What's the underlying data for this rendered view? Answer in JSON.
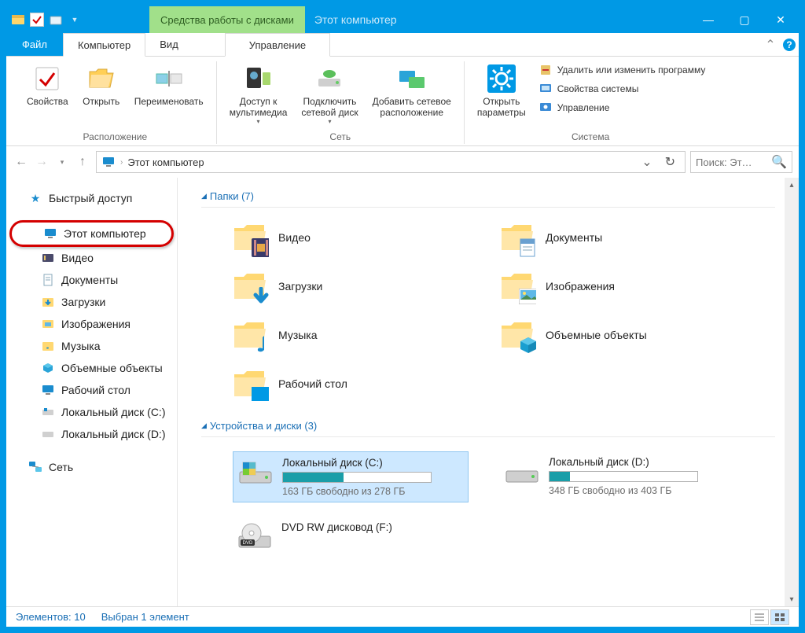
{
  "titlebar": {
    "context_tool": "Средства работы с дисками",
    "title": "Этот компьютер"
  },
  "tabs": {
    "file": "Файл",
    "computer": "Компьютер",
    "view": "Вид",
    "manage": "Управление"
  },
  "ribbon": {
    "properties": "Свойства",
    "open": "Открыть",
    "rename": "Переименовать",
    "group_location": "Расположение",
    "media_access": "Доступ к\nмультимедиа",
    "map_network": "Подключить\nсетевой диск",
    "add_network_location": "Добавить сетевое\nрасположение",
    "group_network": "Сеть",
    "open_settings": "Открыть\nпараметры",
    "uninstall_program": "Удалить или изменить программу",
    "system_properties": "Свойства системы",
    "manage": "Управление",
    "group_system": "Система"
  },
  "address": {
    "path": "Этот компьютер"
  },
  "search": {
    "placeholder": "Поиск: Эт…"
  },
  "sidebar": {
    "quick_access": "Быстрый доступ",
    "this_pc": "Этот компьютер",
    "videos": "Видео",
    "documents": "Документы",
    "downloads": "Загрузки",
    "pictures": "Изображения",
    "music": "Музыка",
    "objects3d": "Объемные объекты",
    "desktop": "Рабочий стол",
    "drive_c": "Локальный диск (C:)",
    "drive_d": "Локальный диск (D:)",
    "network": "Сеть"
  },
  "sections": {
    "folders": "Папки (7)",
    "drives": "Устройства и диски (3)"
  },
  "folders": {
    "videos": "Видео",
    "documents": "Документы",
    "downloads": "Загрузки",
    "pictures": "Изображения",
    "music": "Музыка",
    "objects3d": "Объемные объекты",
    "desktop": "Рабочий стол"
  },
  "drives": {
    "c": {
      "name": "Локальный диск (C:)",
      "free_text": "163 ГБ свободно из 278 ГБ",
      "fill_pct": 41
    },
    "d": {
      "name": "Локальный диск (D:)",
      "free_text": "348 ГБ свободно из 403 ГБ",
      "fill_pct": 14
    },
    "f": {
      "name": "DVD RW дисковод (F:)"
    }
  },
  "statusbar": {
    "elements": "Элементов: 10",
    "selected": "Выбран 1 элемент"
  }
}
